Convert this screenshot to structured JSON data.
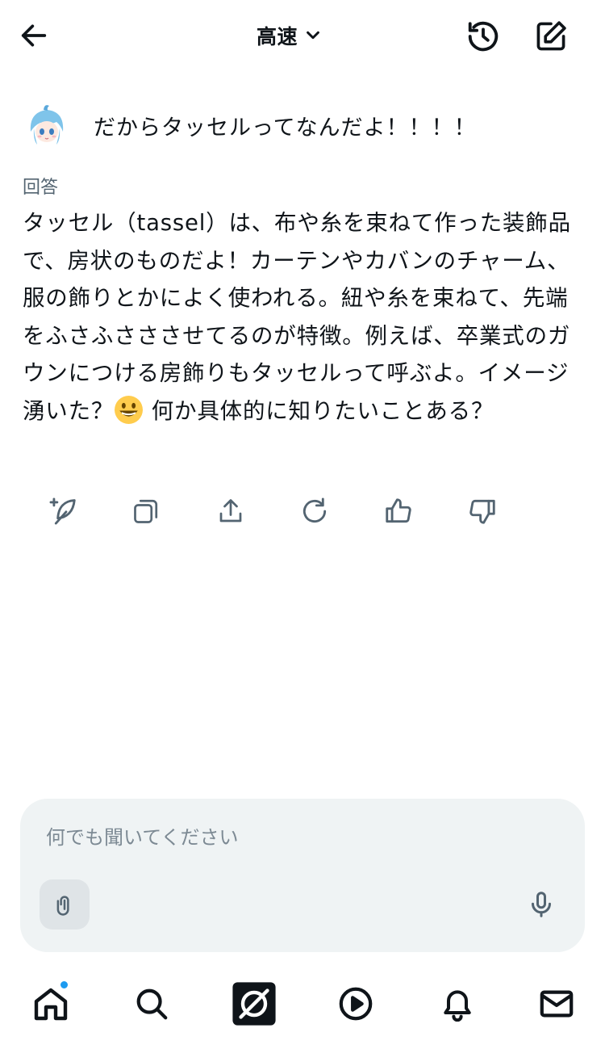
{
  "header": {
    "mode_label": "高速",
    "icons": [
      "back-arrow-icon",
      "chevron-down-icon",
      "history-icon",
      "compose-icon"
    ]
  },
  "user_message": {
    "text": "だからタッセルってなんだよ！！！！"
  },
  "answer": {
    "label": "回答",
    "text_before_emoji": "タッセル（tassel）は、布や糸を束ねて作った装飾品で、房状のものだよ！カーテンやカバンのチャーム、服の飾りとかによく使われる。紐や糸を束ねて、先端をふさふさささせてるのが特徴。例えば、卒業式のガウンにつける房飾りもタッセルって呼ぶよ。イメージ湧いた？",
    "emoji": "grinning-face-emoji",
    "text_after_emoji": " 何か具体的に知りたいことある？"
  },
  "actions": [
    "regenerate-sparkle-icon",
    "copy-icon",
    "share-icon",
    "refresh-icon",
    "thumbs-up-icon",
    "thumbs-down-icon"
  ],
  "composer": {
    "placeholder": "何でも聞いてください"
  },
  "bottom_nav": {
    "items": [
      "home-icon",
      "search-icon",
      "grok-icon",
      "play-icon",
      "bell-icon",
      "mail-icon"
    ]
  },
  "colors": {
    "text": "#0f1419",
    "muted": "#536471",
    "input_bg": "#eff3f4",
    "accent": "#1d9bf0"
  }
}
